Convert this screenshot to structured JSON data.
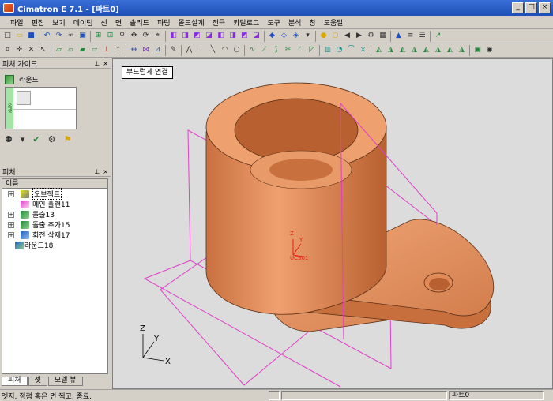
{
  "window": {
    "title": "Cimatron E 7.1 - [파트0]",
    "min": "_",
    "max": "□",
    "close": "×"
  },
  "menu": [
    "파일",
    "편집",
    "보기",
    "데이텀",
    "선",
    "면",
    "솔리드",
    "파팅",
    "몰드설계",
    "전극",
    "카탈로그",
    "도구",
    "분석",
    "창",
    "도움말"
  ],
  "feature_guide": {
    "title": "피처 가이드",
    "feature_name": "라운드",
    "step_strip": "옵셋"
  },
  "feature_tree": {
    "title": "피처",
    "column": "이름",
    "items": [
      {
        "label": "오브젝트",
        "expand": "+",
        "icon": "object-icon",
        "selected": true
      },
      {
        "label": "메인 플랜11",
        "expand": "",
        "icon": "plane-icon",
        "selected": false
      },
      {
        "label": "돌출13",
        "expand": "+",
        "icon": "extrude-icon",
        "selected": false
      },
      {
        "label": "돌출 추가15",
        "expand": "+",
        "icon": "extrude-add-icon",
        "selected": false
      },
      {
        "label": "회전 삭제17",
        "expand": "+",
        "icon": "revolve-cut-icon",
        "selected": false
      },
      {
        "label": "라운드18",
        "expand": "",
        "icon": "round-icon",
        "selected": false
      }
    ],
    "tabs": [
      "피처",
      "셋",
      "모델 뷰"
    ]
  },
  "viewport": {
    "tip": "부드럽게 연결",
    "ucs_label": "UCS01",
    "axes": {
      "x": "X",
      "y": "Y",
      "z": "Z"
    },
    "colors": {
      "part": "#e08a58",
      "plane": "#e040c8",
      "background": "#dcdcdc",
      "ucs": "#e0201e"
    }
  },
  "status": {
    "message": "엣지, 정점 혹은 면 찍고, 종료.",
    "part": "파트0"
  }
}
